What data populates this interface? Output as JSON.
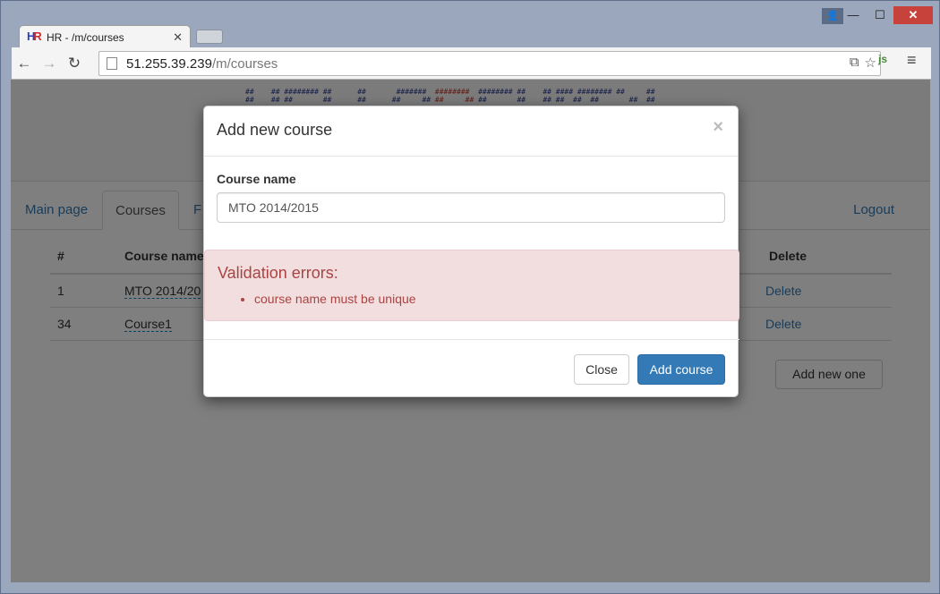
{
  "window": {
    "controls": {
      "minimize": "—",
      "maximize": "☐",
      "close": "✕"
    },
    "user_icon": "user-icon"
  },
  "tab": {
    "title": "HR - /m/courses",
    "favicon_text": "HR"
  },
  "omnibox": {
    "host": "51.255.39.239",
    "path": "/m/courses"
  },
  "page": {
    "nav": {
      "main": "Main page",
      "courses": "Courses",
      "third": "F",
      "logout": "Logout"
    },
    "table": {
      "headers": {
        "num": "#",
        "course_name": "Course name",
        "delete": "Delete"
      },
      "rows": [
        {
          "num": "1",
          "name": "MTO 2014/20",
          "delete": "Delete"
        },
        {
          "num": "34",
          "name": "Course1",
          "delete": "Delete"
        }
      ]
    },
    "add_new_button": "Add new one"
  },
  "modal": {
    "title": "Add new course",
    "close_glyph": "×",
    "course_name_label": "Course name",
    "course_name_value": "MTO 2014/2015",
    "alert_title": "Validation errors:",
    "errors": [
      "course name must be unique"
    ],
    "close_button": "Close",
    "add_button": "Add course"
  },
  "colors": {
    "primary": "#337ab7",
    "danger_bg": "#f2dede",
    "danger_text": "#a94442",
    "close_red": "#c7423a"
  }
}
